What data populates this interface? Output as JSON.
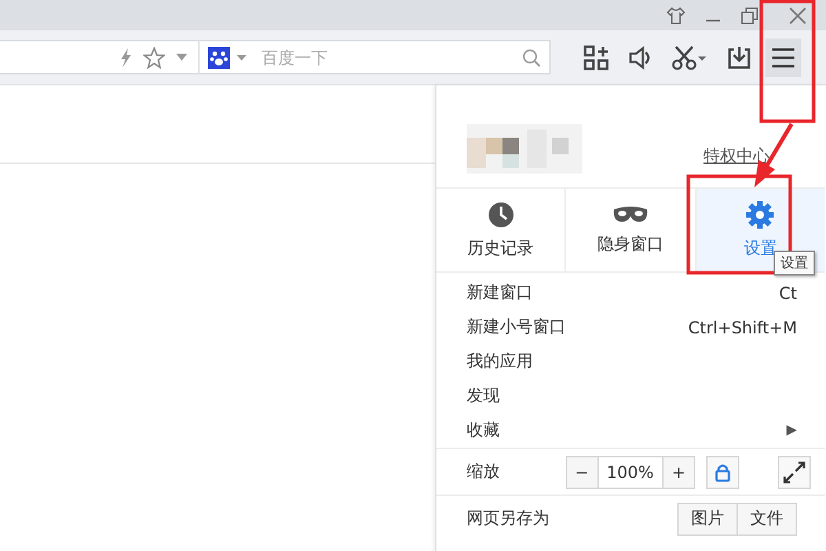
{
  "address_bar": {
    "search": {
      "placeholder": "百度一下"
    }
  },
  "menu": {
    "account": {
      "link": "特权中心"
    },
    "quick_actions": [
      {
        "label": "历史记录",
        "kind": "history",
        "selected": false
      },
      {
        "label": "隐身窗口",
        "kind": "incognito",
        "selected": false
      },
      {
        "label": "设置",
        "kind": "settings",
        "selected": true
      }
    ],
    "tooltip": "设置",
    "items": [
      {
        "label": "新建窗口",
        "shortcut": "Ct"
      },
      {
        "label": "新建小号窗口",
        "shortcut": "Ctrl+Shift+M"
      },
      {
        "label": "我的应用"
      },
      {
        "label": "发现"
      },
      {
        "label": "收藏",
        "arrow": "▶"
      }
    ],
    "zoom": {
      "label": "缩放",
      "minus": "−",
      "value": "100%",
      "plus": "+"
    },
    "save_as": {
      "label": "网页另存为",
      "buttons": [
        "图片",
        "文件"
      ]
    }
  },
  "annotations": [
    {
      "kind": "menu_box"
    },
    {
      "kind": "settings_box"
    },
    {
      "kind": "arrow"
    }
  ]
}
